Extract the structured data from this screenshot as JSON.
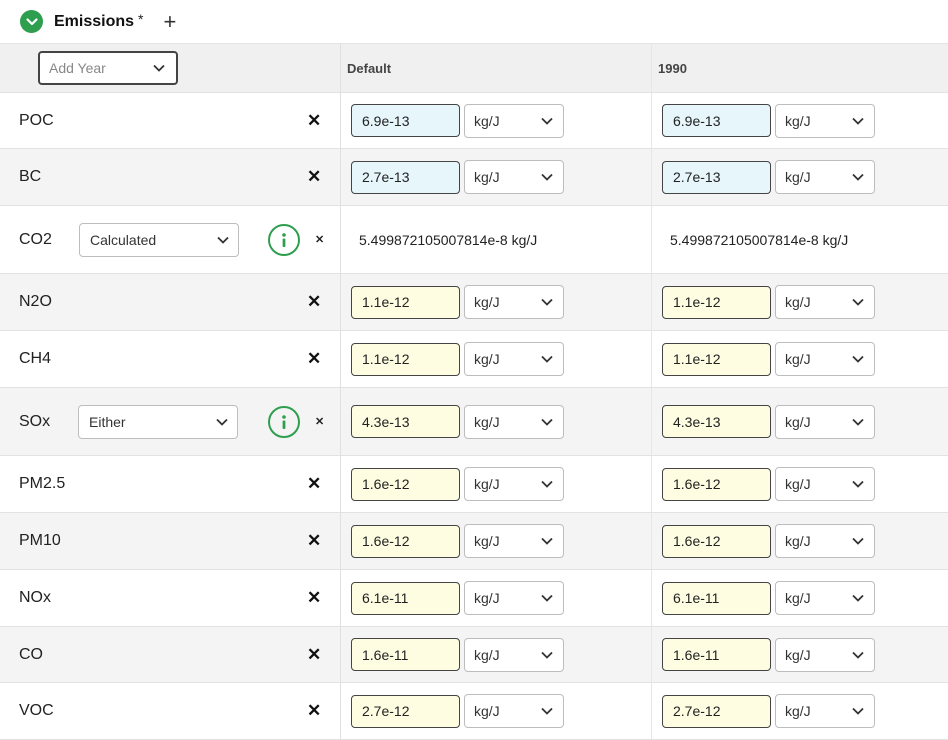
{
  "header": {
    "title": "Emissions",
    "modified_marker": "*",
    "add_symbol": "+"
  },
  "colors": {
    "accent": "#2e9e4f",
    "blue_input": "#e6f6fb",
    "yellow_input": "#fefde1"
  },
  "year_select": {
    "placeholder": "Add Year"
  },
  "columns": [
    "Default",
    "1990"
  ],
  "rows": [
    {
      "name": "POC",
      "type": "value",
      "values": [
        {
          "value": "6.9e-13",
          "unit": "kg/J",
          "style": "blue"
        },
        {
          "value": "6.9e-13",
          "unit": "kg/J",
          "style": "blue"
        }
      ]
    },
    {
      "name": "BC",
      "type": "value",
      "values": [
        {
          "value": "2.7e-13",
          "unit": "kg/J",
          "style": "blue"
        },
        {
          "value": "2.7e-13",
          "unit": "kg/J",
          "style": "blue"
        }
      ]
    },
    {
      "name": "CO2",
      "type": "method",
      "method": "Calculated",
      "values": [
        {
          "text": "5.499872105007814e-8 kg/J"
        },
        {
          "text": "5.499872105007814e-8 kg/J"
        }
      ]
    },
    {
      "name": "N2O",
      "type": "value",
      "values": [
        {
          "value": "1.1e-12",
          "unit": "kg/J",
          "style": "yellow"
        },
        {
          "value": "1.1e-12",
          "unit": "kg/J",
          "style": "yellow"
        }
      ]
    },
    {
      "name": "CH4",
      "type": "value",
      "values": [
        {
          "value": "1.1e-12",
          "unit": "kg/J",
          "style": "yellow"
        },
        {
          "value": "1.1e-12",
          "unit": "kg/J",
          "style": "yellow"
        }
      ]
    },
    {
      "name": "SOx",
      "type": "method-value",
      "method": "Either",
      "values": [
        {
          "value": "4.3e-13",
          "unit": "kg/J",
          "style": "yellow"
        },
        {
          "value": "4.3e-13",
          "unit": "kg/J",
          "style": "yellow"
        }
      ]
    },
    {
      "name": "PM2.5",
      "type": "value",
      "values": [
        {
          "value": "1.6e-12",
          "unit": "kg/J",
          "style": "yellow"
        },
        {
          "value": "1.6e-12",
          "unit": "kg/J",
          "style": "yellow"
        }
      ]
    },
    {
      "name": "PM10",
      "type": "value",
      "values": [
        {
          "value": "1.6e-12",
          "unit": "kg/J",
          "style": "yellow"
        },
        {
          "value": "1.6e-12",
          "unit": "kg/J",
          "style": "yellow"
        }
      ]
    },
    {
      "name": "NOx",
      "type": "value",
      "values": [
        {
          "value": "6.1e-11",
          "unit": "kg/J",
          "style": "yellow"
        },
        {
          "value": "6.1e-11",
          "unit": "kg/J",
          "style": "yellow"
        }
      ]
    },
    {
      "name": "CO",
      "type": "value",
      "values": [
        {
          "value": "1.6e-11",
          "unit": "kg/J",
          "style": "yellow"
        },
        {
          "value": "1.6e-11",
          "unit": "kg/J",
          "style": "yellow"
        }
      ]
    },
    {
      "name": "VOC",
      "type": "value",
      "values": [
        {
          "value": "2.7e-12",
          "unit": "kg/J",
          "style": "yellow"
        },
        {
          "value": "2.7e-12",
          "unit": "kg/J",
          "style": "yellow"
        }
      ]
    }
  ]
}
